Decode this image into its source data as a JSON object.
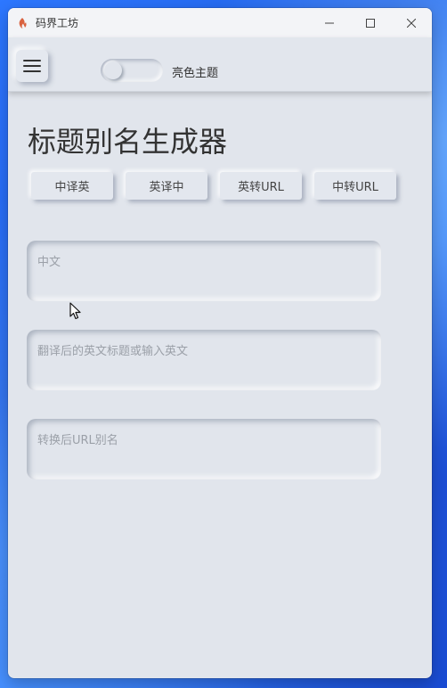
{
  "window": {
    "title": "码界工坊"
  },
  "appbar": {
    "theme_toggle_label": "亮色主题",
    "theme_toggle_on": false
  },
  "main": {
    "title": "标题别名生成器",
    "buttons": [
      {
        "label": "中译英"
      },
      {
        "label": "英译中"
      },
      {
        "label": "英转URL"
      },
      {
        "label": "中转URL"
      }
    ],
    "fields": [
      {
        "placeholder": "中文",
        "value": ""
      },
      {
        "placeholder": "翻译后的英文标题或输入英文",
        "value": ""
      },
      {
        "placeholder": "转换后URL别名",
        "value": ""
      }
    ]
  },
  "colors": {
    "window_bg": "#e1e5ec",
    "icon_accent": "#d9623f"
  },
  "icons": [
    "flame-icon",
    "minimize-icon",
    "maximize-icon",
    "close-icon",
    "hamburger-icon",
    "mouse-cursor-icon"
  ]
}
